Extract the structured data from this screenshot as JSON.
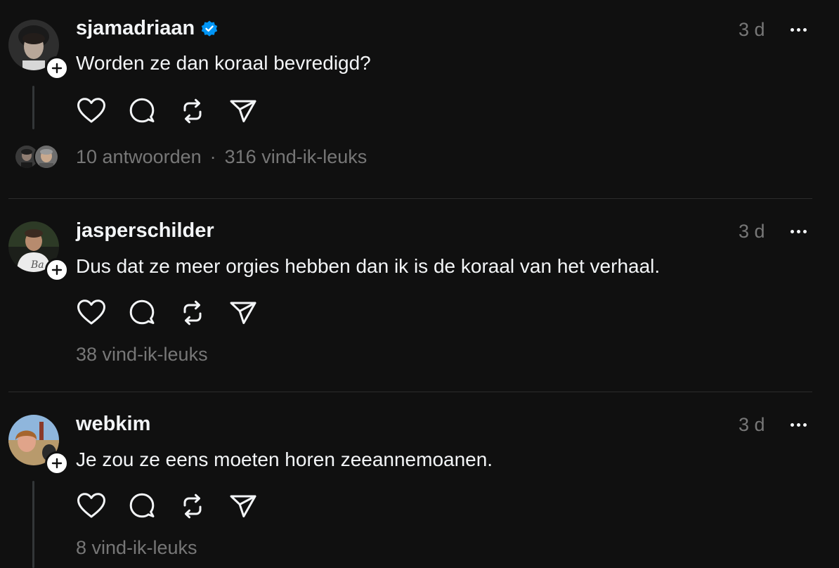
{
  "colors": {
    "background": "#101010",
    "primary_text": "#f3f5f7",
    "secondary_text": "#777777",
    "verified_blue": "#0095f6",
    "divider": "#2c2c2c"
  },
  "actions": {
    "like_icon": "heart-icon",
    "reply_icon": "speech-bubble-icon",
    "repost_icon": "repost-icon",
    "share_icon": "paper-plane-icon",
    "more_icon": "more-options-icon",
    "follow_icon": "plus-icon"
  },
  "posts": [
    {
      "username": "sjamadriaan",
      "verified": true,
      "timestamp": "3 d",
      "text": "Worden ze dan koraal bevredigd?",
      "replies": "10 antwoorden",
      "separator": "·",
      "likes": "316 vind-ik-leuks"
    },
    {
      "username": "jasperschilder",
      "verified": false,
      "timestamp": "3 d",
      "text": "Dus dat ze meer orgies hebben dan ik is de koraal van het verhaal.",
      "likes": "38 vind-ik-leuks"
    },
    {
      "username": "webkim",
      "verified": false,
      "timestamp": "3 d",
      "text": "Je zou ze eens moeten horen zeeannemoanen.",
      "likes": "8 vind-ik-leuks"
    }
  ]
}
